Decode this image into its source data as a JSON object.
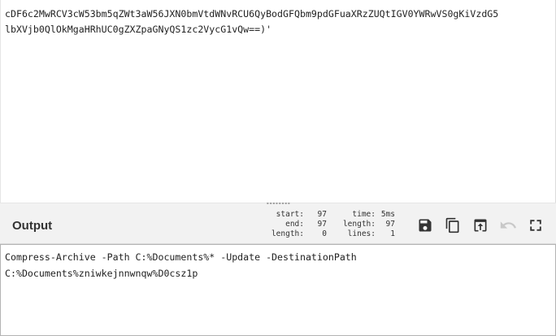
{
  "input": {
    "lines": [
      "cDF6c2MwRCV3cW53bm5qZWt3aW56JXN0bmVtdWNvRCU6QyBodGFQbm9pdGFuaXRzZUQtIGV0YWRwVS0gKiVzdG5",
      "lbXVjb0QlOkMgaHRhUC0gZXZpaGNyQS1zc2VycG1vQw==)'"
    ]
  },
  "output": {
    "title": "Output",
    "stats": {
      "start_label": "start:",
      "start_value": "97",
      "end_label": "end:",
      "end_value": "97",
      "length_label": "length:",
      "length_value": "0",
      "time_label": "time:",
      "time_value": "5ms",
      "length2_label": "length:",
      "length2_value": "97",
      "lines_label": "lines:",
      "lines_value": "1"
    },
    "toolbar": {
      "save_icon": "save-icon",
      "copy_icon": "copy-icon",
      "replace_input_icon": "replace-input-icon",
      "undo_icon": "undo-icon",
      "fullscreen_icon": "fullscreen-icon"
    },
    "lines": [
      "Compress-Archive -Path C:%Documents%* -Update -DestinationPath",
      "C:%Documents%zniwkejnnwnqw%D0csz1p"
    ]
  },
  "colors": {
    "header_bg": "#f2f2f2",
    "icon": "#333333",
    "icon_disabled": "#c8c8c8",
    "border": "#b4b4b4"
  }
}
